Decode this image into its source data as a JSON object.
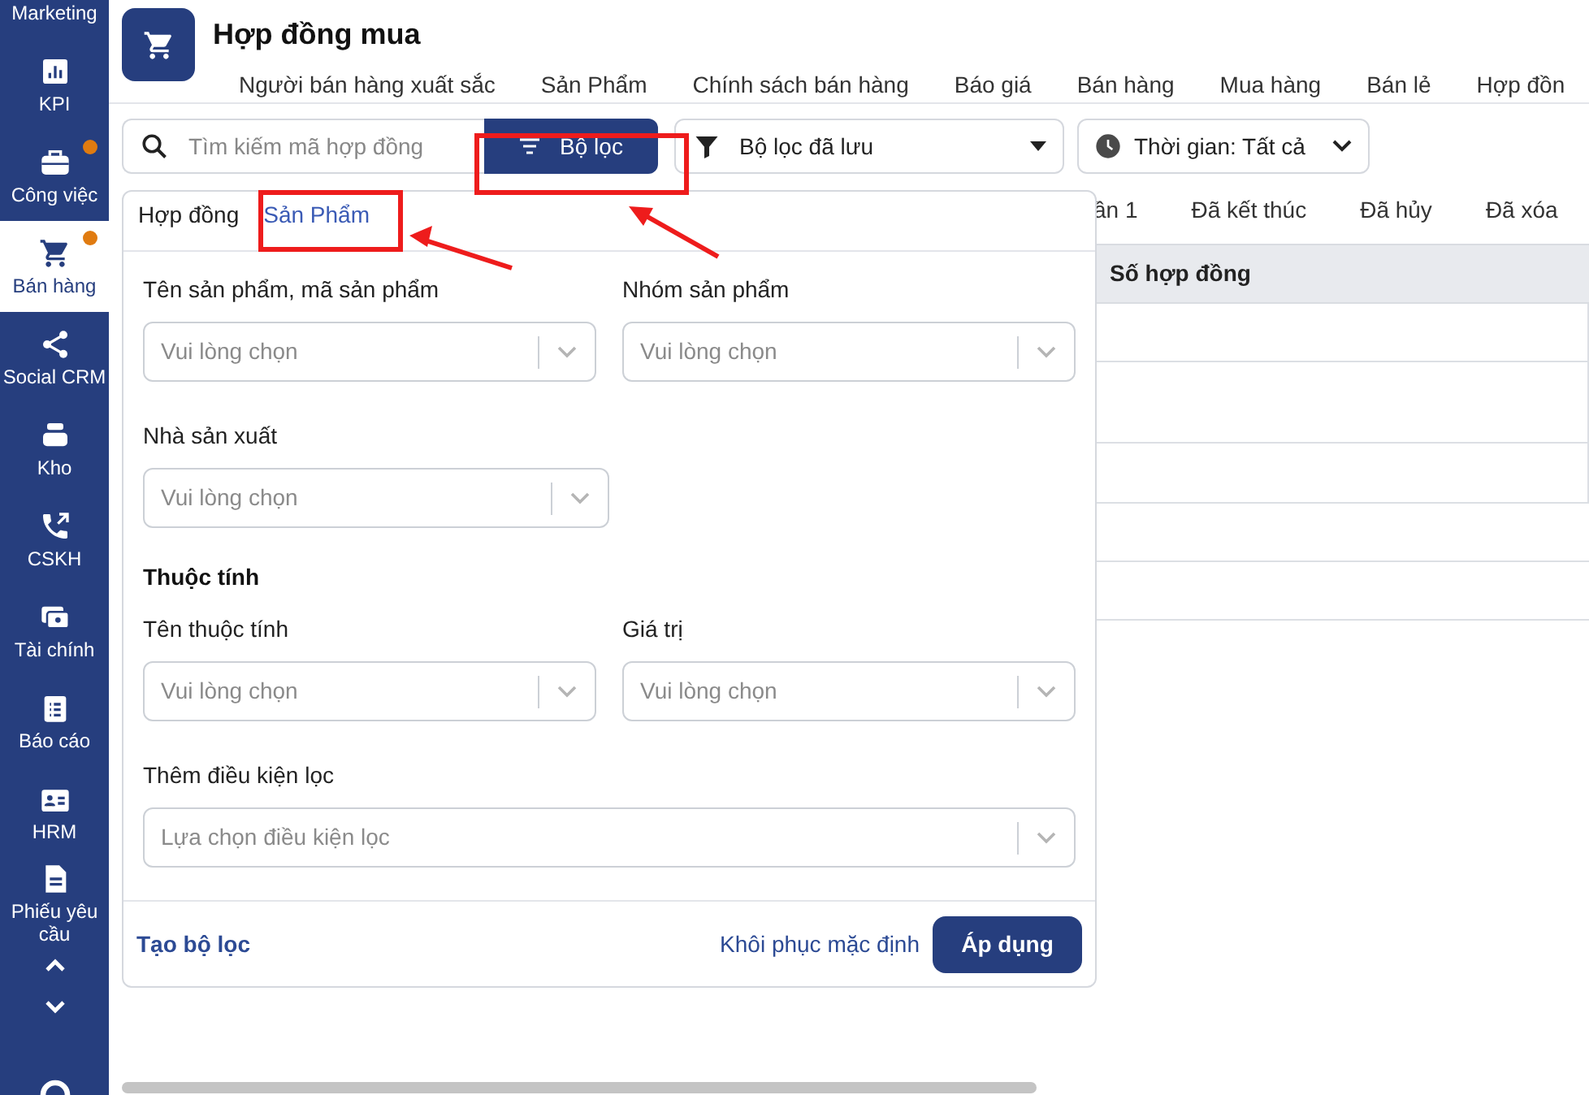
{
  "sidebar": {
    "items": [
      {
        "label": "Marketing",
        "badge": false,
        "selected": false
      },
      {
        "label": "KPI",
        "badge": false,
        "selected": false
      },
      {
        "label": "Công việc",
        "badge": true,
        "selected": false
      },
      {
        "label": "Bán hàng",
        "badge": true,
        "selected": true
      },
      {
        "label": "Social CRM",
        "badge": false,
        "selected": false
      },
      {
        "label": "Kho",
        "badge": false,
        "selected": false
      },
      {
        "label": "CSKH",
        "badge": false,
        "selected": false
      },
      {
        "label": "Tài chính",
        "badge": false,
        "selected": false
      },
      {
        "label": "Báo cáo",
        "badge": false,
        "selected": false
      },
      {
        "label": "HRM",
        "badge": false,
        "selected": false
      },
      {
        "label": "Phiếu yêu cầu",
        "badge": false,
        "selected": false
      }
    ]
  },
  "header": {
    "title": "Hợp đồng mua",
    "nav_tabs": [
      "Người bán hàng xuất sắc",
      "Sản Phẩm",
      "Chính sách bán hàng",
      "Báo giá",
      "Bán hàng",
      "Mua hàng",
      "Bán lẻ",
      "Hợp đồn"
    ]
  },
  "toolbar": {
    "search": {
      "placeholder": "Tìm kiếm mã hợp đồng"
    },
    "filter_button": "Bộ lọc",
    "saved_filter": "Bộ lọc đã lưu",
    "time_filter": "Thời gian: Tất cả"
  },
  "status_tabs": [
    "ần 1",
    "Đã kết thúc",
    "Đã hủy",
    "Đã xóa"
  ],
  "table": {
    "columns": [
      "Số hợp đồng"
    ]
  },
  "filter_panel": {
    "tabs": [
      {
        "label": "Hợp đồng",
        "selected": false
      },
      {
        "label": "Sản Phẩm",
        "selected": true
      }
    ],
    "rows": [
      {
        "kind": "pair",
        "fields": [
          {
            "label": "Tên sản phẩm, mã sản phẩm",
            "placeholder": "Vui lòng chọn"
          },
          {
            "label": "Nhóm sản phẩm",
            "placeholder": "Vui lòng chọn"
          }
        ]
      },
      {
        "kind": "single",
        "fields": [
          {
            "label": "Nhà sản xuất",
            "placeholder": "Vui lòng chọn"
          }
        ]
      },
      {
        "kind": "heading",
        "text": "Thuộc tính"
      },
      {
        "kind": "pair",
        "fields": [
          {
            "label": "Tên thuộc tính",
            "placeholder": "Vui lòng chọn"
          },
          {
            "label": "Giá trị",
            "placeholder": "Vui lòng chọn"
          }
        ]
      },
      {
        "kind": "wide",
        "fields": [
          {
            "label": "Thêm điều kiện lọc",
            "placeholder": "Lựa chọn điều kiện lọc"
          }
        ]
      }
    ],
    "create_filter": "Tạo bộ lọc",
    "reset": "Khôi phục mặc định",
    "apply": "Áp dụng"
  }
}
